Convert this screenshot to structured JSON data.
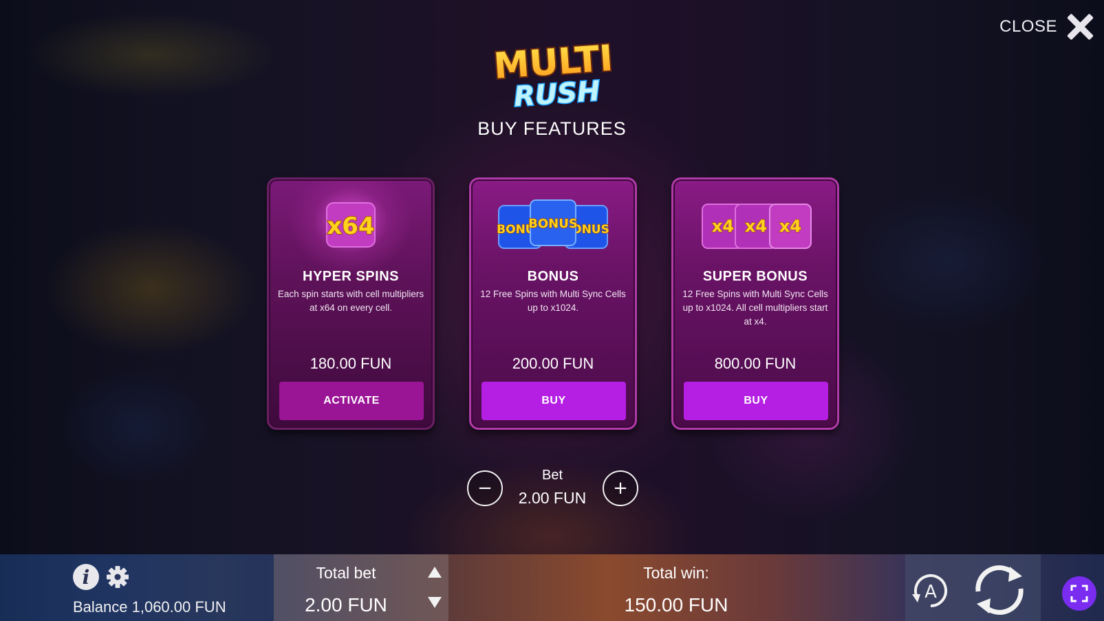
{
  "header": {
    "close_label": "CLOSE",
    "title": "BUY FEATURES",
    "logo_text_top": "MULTI",
    "logo_text_bottom": "RUSH"
  },
  "cards": [
    {
      "art_chips": [
        "x64"
      ],
      "title": "HYPER SPINS",
      "description": "Each spin starts with cell multipliers at x64 on every cell.",
      "price": "180.00 FUN",
      "button": "ACTIVATE"
    },
    {
      "art_chips": [
        "BONUS",
        "BONUS",
        "BONUS"
      ],
      "title": "BONUS",
      "description": "12 Free Spins with Multi Sync Cells up to x1024.",
      "price": "200.00 FUN",
      "button": "BUY"
    },
    {
      "art_chips": [
        "x4",
        "x4",
        "x4"
      ],
      "title": "SUPER BONUS",
      "description": "12 Free Spins with Multi Sync Cells up to x1024. All cell multipliers start at x4.",
      "price": "800.00 FUN",
      "button": "BUY"
    }
  ],
  "bet": {
    "label": "Bet",
    "value": "2.00 FUN",
    "minus": "−",
    "plus": "+"
  },
  "bottom_bar": {
    "balance": "Balance 1,060.00 FUN",
    "total_bet_label": "Total bet",
    "total_bet_value": "2.00 FUN",
    "total_win_label": "Total win:",
    "total_win_value": "150.00 FUN",
    "autoplay_letter": "A",
    "info_letter": "i"
  },
  "colors": {
    "buy_button": "#b41fe3",
    "activate_button": "#9a1596",
    "fullscreen_button": "#7a2cf0",
    "chip_yellow": "#ffd21e",
    "chip_blue": "#1e54e8"
  },
  "icons": [
    "close-icon",
    "info-icon",
    "gear-icon",
    "arrow-up-icon",
    "arrow-down-icon",
    "autoplay-icon",
    "spin-icon",
    "fullscreen-icon"
  ]
}
